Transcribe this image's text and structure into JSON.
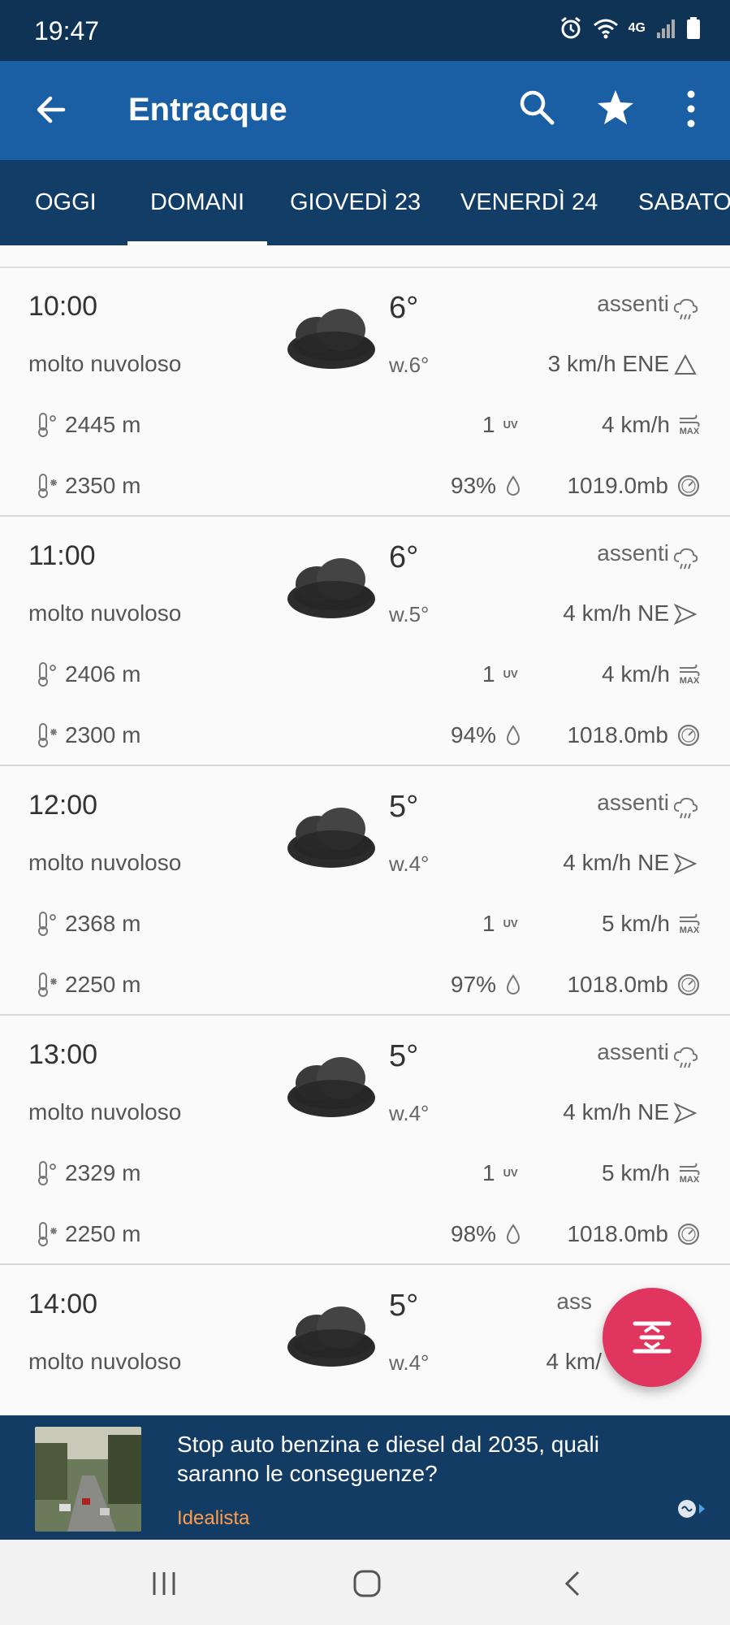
{
  "status_bar": {
    "time": "19:47",
    "network": "4G",
    "icons": [
      "alarm-icon",
      "wifi-icon",
      "network-4g-icon",
      "signal-icon",
      "battery-icon"
    ]
  },
  "app_bar": {
    "title": "Entracque",
    "color": "#1a5fa3"
  },
  "tabs": [
    {
      "label": "OGGI"
    },
    {
      "label": "DOMANI",
      "selected": true
    },
    {
      "label": "GIOVEDÌ 23"
    },
    {
      "label": "VENERDÌ 24"
    },
    {
      "label": "SABATO"
    }
  ],
  "hours": [
    {
      "time": "10:00",
      "desc": "molto nuvoloso",
      "temp": "6°",
      "windchill": "w.6°",
      "rain": "assenti",
      "wind": "3 km/h ENE",
      "iso0": "2445 m",
      "uv": "1",
      "gust": "4 km/h",
      "snow": "2350 m",
      "humidity": "93%",
      "pressure": "1019.0mb"
    },
    {
      "time": "11:00",
      "desc": "molto nuvoloso",
      "temp": "6°",
      "windchill": "w.5°",
      "rain": "assenti",
      "wind": "4 km/h NE",
      "iso0": "2406 m",
      "uv": "1",
      "gust": "4 km/h",
      "snow": "2300 m",
      "humidity": "94%",
      "pressure": "1018.0mb"
    },
    {
      "time": "12:00",
      "desc": "molto nuvoloso",
      "temp": "5°",
      "windchill": "w.4°",
      "rain": "assenti",
      "wind": "4 km/h NE",
      "iso0": "2368 m",
      "uv": "1",
      "gust": "5 km/h",
      "snow": "2250 m",
      "humidity": "97%",
      "pressure": "1018.0mb"
    },
    {
      "time": "13:00",
      "desc": "molto nuvoloso",
      "temp": "5°",
      "windchill": "w.4°",
      "rain": "assenti",
      "wind": "4 km/h NE",
      "iso0": "2329 m",
      "uv": "1",
      "gust": "5 km/h",
      "snow": "2250 m",
      "humidity": "98%",
      "pressure": "1018.0mb"
    },
    {
      "time": "14:00",
      "desc": "molto nuvoloso",
      "temp": "5°",
      "windchill": "w.4°",
      "rain": "ass",
      "wind": "4 km/"
    }
  ],
  "labels": {
    "uv": "UV",
    "max": "MAX"
  },
  "fab": {
    "icon": "collapse-icon",
    "color": "#e0355f"
  },
  "ad": {
    "headline": "Stop auto benzina e diesel dal 2035, quali saranno le conseguenze?",
    "source": "Idealista",
    "source_color": "#ff9d4b"
  },
  "nav_bar": {
    "icons": [
      "recent-apps-icon",
      "home-icon",
      "back-nav-icon"
    ]
  }
}
